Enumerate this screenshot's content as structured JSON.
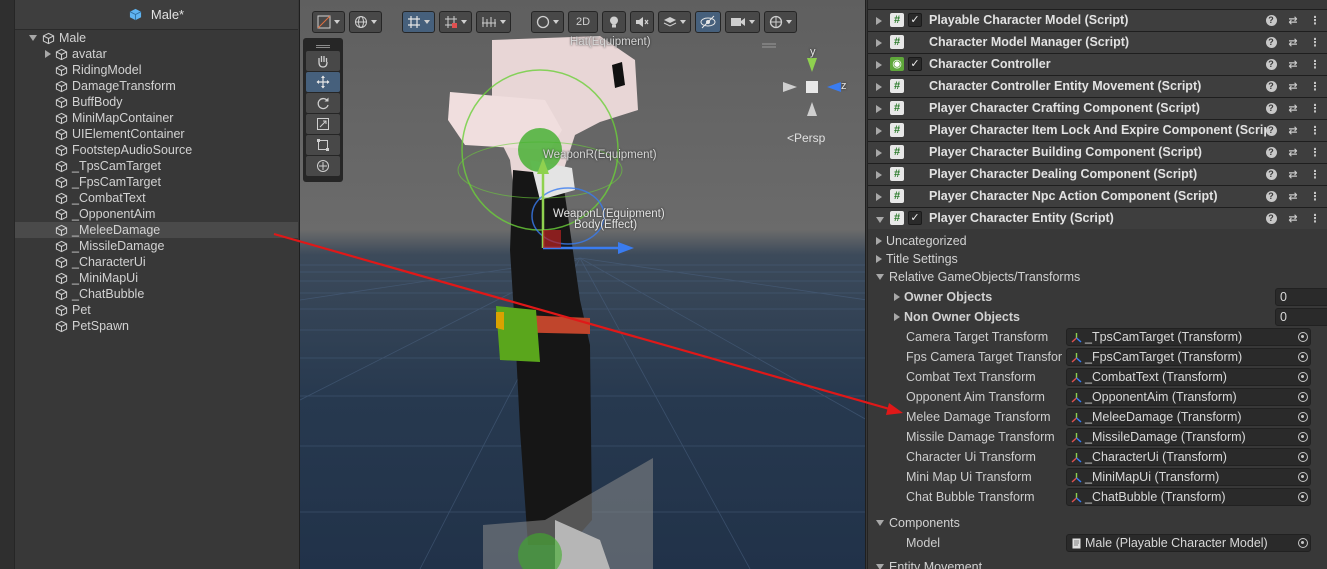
{
  "hierarchy": {
    "title": "Male*",
    "root": "Male",
    "children": [
      "avatar",
      "RidingModel",
      "DamageTransform",
      "BuffBody",
      "MiniMapContainer",
      "UIElementContainer",
      "FootstepAudioSource",
      "_TpsCamTarget",
      "_FpsCamTarget",
      "_CombatText",
      "_OpponentAim",
      "_MeleeDamage",
      "_MissileDamage",
      "_CharacterUi",
      "_MiniMapUi",
      "_ChatBubble",
      "Pet",
      "PetSpawn"
    ],
    "selected": "_MeleeDamage"
  },
  "scene": {
    "toolbar": {
      "mode_2d": "2D"
    },
    "labels": {
      "hat": "Hat(Equipment)",
      "weapon_r": "WeaponR(Equipment)",
      "weapon_l": "WeaponL(Equipment)",
      "body_effect": "Body(Effect)",
      "persp": "<Persp"
    },
    "gizmo_axes": {
      "y": "y",
      "z": "z"
    }
  },
  "inspector": {
    "components": [
      {
        "label": "Playable Character Model (Script)",
        "checkbox": true,
        "icon": "script-icon"
      },
      {
        "label": "Character Model Manager (Script)",
        "checkbox": false,
        "icon": "script-icon"
      },
      {
        "label": "Character Controller",
        "checkbox": true,
        "icon": "capsule-icon"
      },
      {
        "label": "Character Controller Entity Movement (Script)",
        "checkbox": false,
        "icon": "script-icon"
      },
      {
        "label": "Player Character Crafting Component (Script)",
        "checkbox": false,
        "icon": "script-icon"
      },
      {
        "label": "Player Character Item Lock And Expire Component (Scrip",
        "checkbox": false,
        "icon": "script-icon"
      },
      {
        "label": "Player Character Building Component (Script)",
        "checkbox": false,
        "icon": "script-icon"
      },
      {
        "label": "Player Character Dealing Component (Script)",
        "checkbox": false,
        "icon": "script-icon"
      },
      {
        "label": "Player Character Npc Action Component (Script)",
        "checkbox": false,
        "icon": "script-icon"
      },
      {
        "label": "Player Character Entity (Script)",
        "checkbox": true,
        "icon": "script-icon",
        "expanded": true
      }
    ],
    "sections": {
      "uncategorized": "Uncategorized",
      "title_settings": "Title Settings",
      "relative": "Relative GameObjects/Transforms",
      "components": "Components",
      "entity_movement": "Entity Movement"
    },
    "owner_objects": {
      "label": "Owner Objects",
      "value": "0"
    },
    "non_owner_objects": {
      "label": "Non Owner Objects",
      "value": "0"
    },
    "transforms": [
      {
        "label": "Camera Target Transform",
        "value": "_TpsCamTarget (Transform)"
      },
      {
        "label": "Fps Camera Target Transfor",
        "value": "_FpsCamTarget (Transform)"
      },
      {
        "label": "Combat Text Transform",
        "value": "_CombatText (Transform)"
      },
      {
        "label": "Opponent Aim Transform",
        "value": "_OpponentAim (Transform)"
      },
      {
        "label": "Melee Damage Transform",
        "value": "_MeleeDamage (Transform)"
      },
      {
        "label": "Missile Damage Transform",
        "value": "_MissileDamage (Transform)"
      },
      {
        "label": "Character Ui Transform",
        "value": "_CharacterUi (Transform)"
      },
      {
        "label": "Mini Map Ui Transform",
        "value": "_MiniMapUi (Transform)"
      },
      {
        "label": "Chat Bubble Transform",
        "value": "_ChatBubble (Transform)"
      }
    ],
    "model": {
      "label": "Model",
      "value": "Male (Playable Character Model)"
    }
  },
  "colors": {
    "arrow": "#e01818",
    "accent": "#46607c",
    "axis_x": "#e0e0e0",
    "axis_y": "#8fd14f",
    "axis_z": "#3a7cf0"
  }
}
